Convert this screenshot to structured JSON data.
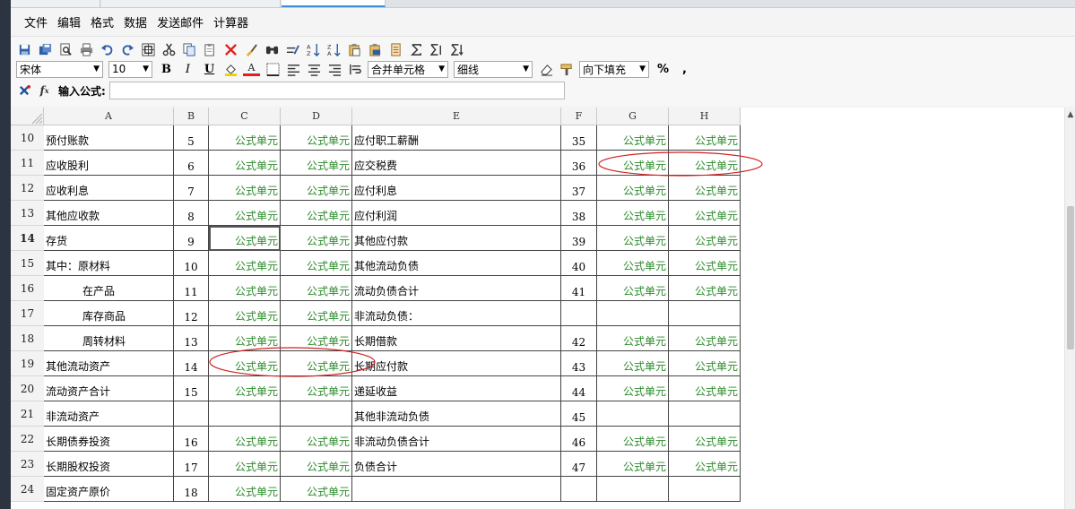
{
  "menu": [
    "文件",
    "编辑",
    "格式",
    "数据",
    "发送邮件",
    "计算器"
  ],
  "toolbar2": {
    "font": "宋体",
    "font_size": "10",
    "bold": "B",
    "italic": "I",
    "underline": "U",
    "font_color": "A",
    "merge": "合并单元格",
    "border": "细线",
    "fill": "向下填充",
    "percent": "%",
    "comma": ","
  },
  "formula": {
    "label": "输入公式:",
    "value": ""
  },
  "columns": [
    "A",
    "B",
    "C",
    "D",
    "E",
    "F",
    "G",
    "H"
  ],
  "rows": [
    {
      "n": "10",
      "a": "预付账款",
      "b": "5",
      "c": "公式单元",
      "d": "公式单元",
      "e": "应付职工薪酬",
      "f": "35",
      "g": "公式单元",
      "h": "公式单元"
    },
    {
      "n": "11",
      "a": "应收股利",
      "b": "6",
      "c": "公式单元",
      "d": "公式单元",
      "e": "应交税费",
      "f": "36",
      "g": "公式单元",
      "h": "公式单元"
    },
    {
      "n": "12",
      "a": "应收利息",
      "b": "7",
      "c": "公式单元",
      "d": "公式单元",
      "e": "应付利息",
      "f": "37",
      "g": "公式单元",
      "h": "公式单元"
    },
    {
      "n": "13",
      "a": "其他应收款",
      "b": "8",
      "c": "公式单元",
      "d": "公式单元",
      "e": "应付利润",
      "f": "38",
      "g": "公式单元",
      "h": "公式单元"
    },
    {
      "n": "14",
      "a": "存货",
      "b": "9",
      "c": "公式单元",
      "d": "公式单元",
      "e": "其他应付款",
      "f": "39",
      "g": "公式单元",
      "h": "公式单元"
    },
    {
      "n": "15",
      "a": "其中：原材料",
      "b": "10",
      "c": "公式单元",
      "d": "公式单元",
      "e": "其他流动负债",
      "f": "40",
      "g": "公式单元",
      "h": "公式单元"
    },
    {
      "n": "16",
      "a": "在产品",
      "b": "11",
      "c": "公式单元",
      "d": "公式单元",
      "e": "流动负债合计",
      "f": "41",
      "g": "公式单元",
      "h": "公式单元"
    },
    {
      "n": "17",
      "a": "库存商品",
      "b": "12",
      "c": "公式单元",
      "d": "公式单元",
      "e": "非流动负债：",
      "f": "",
      "g": "",
      "h": ""
    },
    {
      "n": "18",
      "a": "周转材料",
      "b": "13",
      "c": "公式单元",
      "d": "公式单元",
      "e": "长期借款",
      "f": "42",
      "g": "公式单元",
      "h": "公式单元"
    },
    {
      "n": "19",
      "a": "其他流动资产",
      "b": "14",
      "c": "公式单元",
      "d": "公式单元",
      "e": "长期应付款",
      "f": "43",
      "g": "公式单元",
      "h": "公式单元"
    },
    {
      "n": "20",
      "a": "流动资产合计",
      "b": "15",
      "c": "公式单元",
      "d": "公式单元",
      "e": "递延收益",
      "f": "44",
      "g": "公式单元",
      "h": "公式单元"
    },
    {
      "n": "21",
      "a": "非流动资产",
      "b": "",
      "c": "",
      "d": "",
      "e": "其他非流动负债",
      "f": "45",
      "g": "",
      "h": ""
    },
    {
      "n": "22",
      "a": "长期债券投资",
      "b": "16",
      "c": "公式单元",
      "d": "公式单元",
      "e": "非流动负债合计",
      "f": "46",
      "g": "公式单元",
      "h": "公式单元"
    },
    {
      "n": "23",
      "a": "长期股权投资",
      "b": "17",
      "c": "公式单元",
      "d": "公式单元",
      "e": "负债合计",
      "f": "47",
      "g": "公式单元",
      "h": "公式单元"
    },
    {
      "n": "24",
      "a": "固定资产原价",
      "b": "18",
      "c": "公式单元",
      "d": "公式单元",
      "e": "",
      "f": "",
      "g": "",
      "h": ""
    }
  ],
  "indented_rows": [
    "16",
    "17",
    "18"
  ],
  "active_row": "14",
  "selected_cell": "C14",
  "colors": {
    "formula_text": "#2a8a2a",
    "annotation": "#d22222",
    "tab_active": "#3d8fe0"
  }
}
